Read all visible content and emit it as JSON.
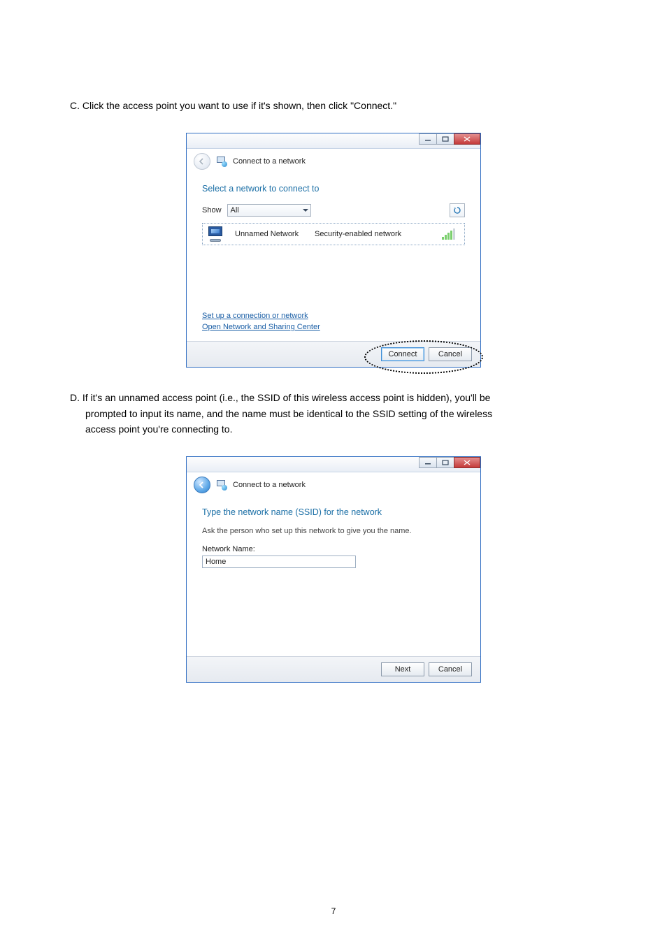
{
  "stepC": {
    "letter": "C.",
    "text": "Click the access point you want to use if it's shown, then click \"Connect.\""
  },
  "stepD": {
    "letter": "D.",
    "line1": "If it's an unnamed access point (i.e., the SSID of this wireless access point is hidden), you'll be",
    "line2": "prompted to input its name, and the name must be identical to the SSID setting of the wireless",
    "line3": "access point you're connecting to."
  },
  "dialog1": {
    "title": "Connect to a network",
    "heading": "Select a network to connect to",
    "show_label": "Show",
    "show_value": "All",
    "network_name": "Unnamed Network",
    "network_type": "Security-enabled network",
    "link_setup": "Set up a connection or network",
    "link_sharing": "Open Network and Sharing Center",
    "btn_connect": "Connect",
    "btn_cancel": "Cancel"
  },
  "dialog2": {
    "title": "Connect to a network",
    "heading": "Type the network name (SSID) for the network",
    "hint": "Ask the person who set up this network to give you the name.",
    "field_label": "Network Name:",
    "field_value": "Home",
    "btn_next": "Next",
    "btn_cancel": "Cancel"
  },
  "page_number": "7"
}
